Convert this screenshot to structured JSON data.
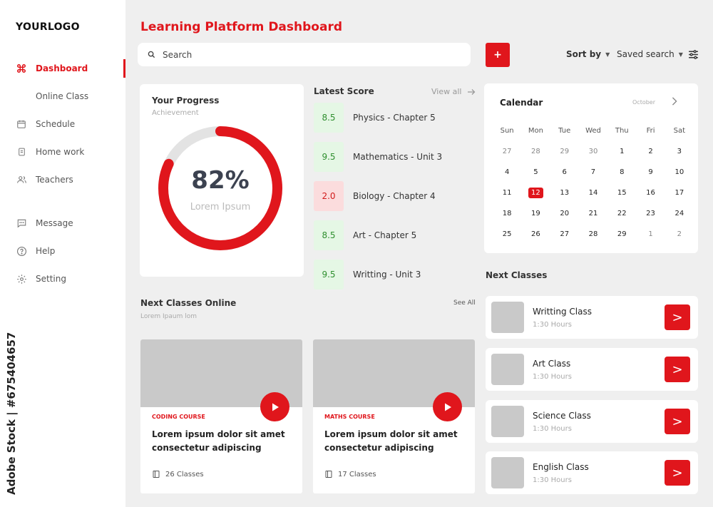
{
  "sidebar": {
    "logo": "YOURLOGO",
    "items": [
      {
        "label": "Dashboard",
        "icon": "command-icon"
      },
      {
        "label": "Online Class",
        "icon": ""
      },
      {
        "label": "Schedule",
        "icon": "calendar-icon"
      },
      {
        "label": "Home work",
        "icon": "document-icon"
      },
      {
        "label": "Teachers",
        "icon": "users-icon"
      },
      {
        "label": "Message",
        "icon": "message-icon"
      },
      {
        "label": "Help",
        "icon": "help-icon"
      },
      {
        "label": "Setting",
        "icon": "gear-icon"
      }
    ],
    "watermark": "Adobe Stock | #675404657"
  },
  "header": {
    "title": "Learning Platform Dashboard",
    "search_placeholder": "Search",
    "add_label": "+",
    "sort_label": "Sort by",
    "saved_label": "Saved search"
  },
  "progress": {
    "title": "Your Progress",
    "subtitle": "Achievement",
    "percent_label": "82%",
    "percent_value": 82,
    "caption": "Lorem Ipsum"
  },
  "latest_score": {
    "title": "Latest Score",
    "view_all": "View all",
    "items": [
      {
        "score": "8.5",
        "subject": "Physics - Chapter 5",
        "status": "good"
      },
      {
        "score": "9.5",
        "subject": "Mathematics - Unit 3",
        "status": "good"
      },
      {
        "score": "2.0",
        "subject": "Biology - Chapter 4",
        "status": "bad"
      },
      {
        "score": "8.5",
        "subject": "Art - Chapter 5",
        "status": "good"
      },
      {
        "score": "9.5",
        "subject": "Writting - Unit 3",
        "status": "good"
      }
    ]
  },
  "calendar": {
    "title": "Calendar",
    "month": "October",
    "weekdays": [
      "Sun",
      "Mon",
      "Tue",
      "Wed",
      "Thu",
      "Fri",
      "Sat"
    ],
    "weeks": [
      [
        "27",
        "28",
        "29",
        "30",
        "1",
        "2",
        "3"
      ],
      [
        "4",
        "5",
        "6",
        "7",
        "8",
        "9",
        "10"
      ],
      [
        "11",
        "12",
        "13",
        "14",
        "15",
        "16",
        "17"
      ],
      [
        "18",
        "19",
        "20",
        "21",
        "22",
        "23",
        "24"
      ],
      [
        "25",
        "26",
        "27",
        "28",
        "29",
        "1",
        "2"
      ]
    ],
    "today": "12"
  },
  "next_classes_online": {
    "title": "Next Classes Online",
    "subtitle": "Lorem Ipaum lom",
    "see_all": "See All",
    "courses": [
      {
        "category": "CODING COURSE",
        "heading": "Lorem ipsum dolor sit amet consectetur adipiscing",
        "count": "26 Classes"
      },
      {
        "category": "MATHS COURSE",
        "heading": "Lorem ipsum dolor sit amet consectetur adipiscing",
        "count": "17 Classes"
      }
    ]
  },
  "next_classes": {
    "title": "Next Classes",
    "go_label": ">",
    "items": [
      {
        "name": "Writting Class",
        "duration": "1:30 Hours"
      },
      {
        "name": "Art Class",
        "duration": "1:30 Hours"
      },
      {
        "name": "Science Class",
        "duration": "1:30 Hours"
      },
      {
        "name": "English Class",
        "duration": "1:30 Hours"
      }
    ]
  },
  "colors": {
    "accent": "#e0161c",
    "score_good_bg": "#e5f7e5",
    "score_bad_bg": "#fbdcdd",
    "background": "#efefef"
  }
}
